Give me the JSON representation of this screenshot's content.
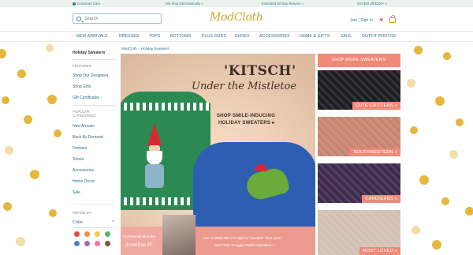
{
  "topbar": {
    "customer_care": "Customer Care",
    "ship_intl": "We Ship Internationally »",
    "returns": "Extended 60-Day Returns »",
    "promo": "Get $20 off $100+ »"
  },
  "header": {
    "search_placeholder": "Search",
    "logo": "ModCloth",
    "join": "Join | Sign In"
  },
  "nav": {
    "items": [
      "NEW ARRIVALS",
      "DRESSES",
      "TOPS",
      "BOTTOMS",
      "PLUS SIZES",
      "SHOES",
      "ACCESSORIES",
      "HOME & GIFTS",
      "SALE",
      "OUTFIT PHOTOS"
    ]
  },
  "sidebar": {
    "title": "Holiday Sweaters",
    "features_head": "FEATURES:",
    "features": [
      "Shop Our Designers",
      "Shop Gifts",
      "Gift Certificates"
    ],
    "categories_head": "POPULAR CATEGORIES:",
    "categories": [
      "New Arrivals",
      "Back By Demand",
      "Dresses",
      "Shoes",
      "Accessories",
      "Home Decor",
      "Sale"
    ],
    "refine": "REFINE BY:",
    "color_label": "Color",
    "chevron": "^",
    "swatches": [
      "#e04b3c",
      "#f2913d",
      "#f1c84a",
      "#57b36c",
      "#4a86d0",
      "#a666b8",
      "#e77aa6",
      "#7b5a3e"
    ]
  },
  "breadcrumb": {
    "root": "ModCloth",
    "sep": "»",
    "current": "Holiday Sweaters"
  },
  "hero": {
    "headline": "'KITSCH'",
    "subhead": "Under the Mistletoe",
    "cta_line1": "SHOP SMILE-INDUCING",
    "cta_line2": "HOLIDAY SWEATERS ▸"
  },
  "community": {
    "label": "Community Member",
    "name": "Annelise H.",
    "line1": "Our COMMUNITY'S style is \"sweater\" than ever!",
    "line2": "See Their Snuggly Outfit Inspiration »"
  },
  "shop_more": {
    "title": "SHOP MORE SWEATERS:",
    "tiles": [
      {
        "label": "CUTE CRITTERS »",
        "color": "#1c1c22"
      },
      {
        "label": "SOUTHWESTERN »",
        "color": "#c9846f"
      },
      {
        "label": "CARDIGANS »",
        "color": "#3d2b4d"
      },
      {
        "label": "MOST LOVED »",
        "color": "#d3c1b3"
      }
    ]
  }
}
